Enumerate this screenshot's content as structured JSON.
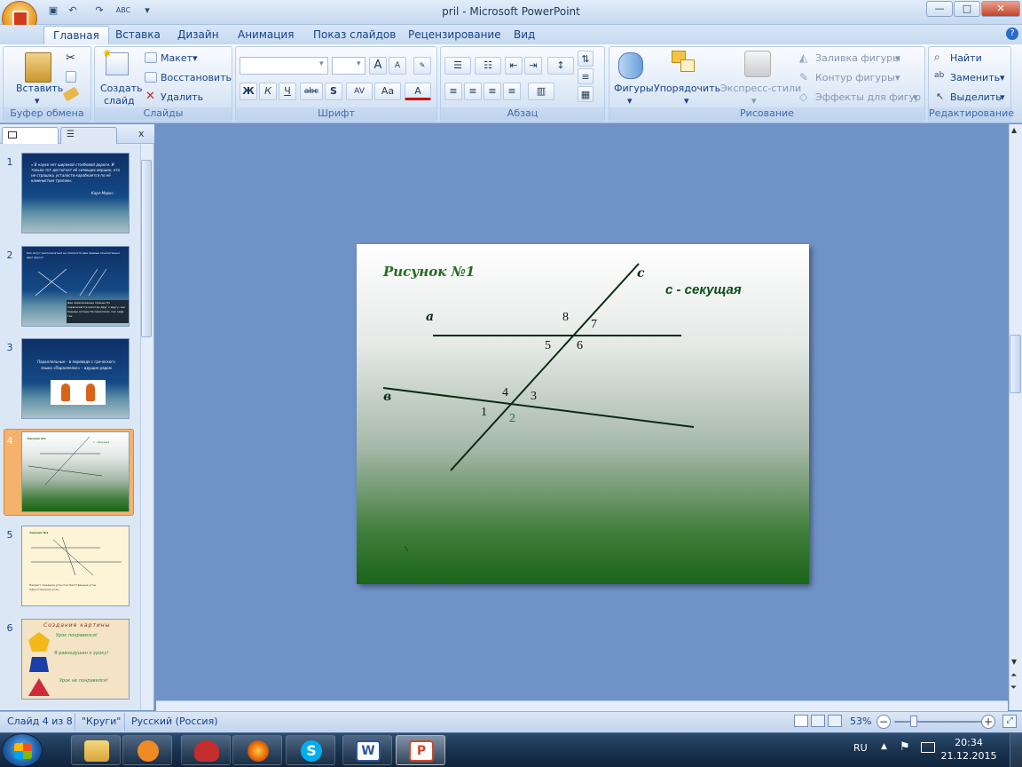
{
  "window": {
    "title": "pril - Microsoft PowerPoint",
    "min": "—",
    "max": "□",
    "close": "✕"
  },
  "qat": {
    "save": "💾",
    "undo": "↶",
    "redo": "↷",
    "spell": "ABC"
  },
  "tabs": [
    "Главная",
    "Вставка",
    "Дизайн",
    "Анимация",
    "Показ слайдов",
    "Рецензирование",
    "Вид"
  ],
  "ribbon": {
    "clipboard": {
      "label": "Буфер обмена",
      "paste": "Вставить"
    },
    "slides": {
      "label": "Слайды",
      "create": "Создать",
      "create2": "слайд",
      "layout": "Макет",
      "reset": "Восстановить",
      "delete": "Удалить"
    },
    "font": {
      "label": "Шрифт",
      "bold": "Ж",
      "italic": "К",
      "underline": "Ч",
      "strike": "abc",
      "shadow": "S",
      "spacing": "AV",
      "case": "Aa",
      "color": "A",
      "grow": "A",
      "shrink": "A"
    },
    "paragraph": {
      "label": "Абзац"
    },
    "drawing": {
      "label": "Рисование",
      "shapes": "Фигуры",
      "arrange": "Упорядочить",
      "styles": "Экспресс-стили",
      "fill": "Заливка фигуры",
      "outline": "Контур фигуры",
      "effects": "Эффекты для фигур"
    },
    "editing": {
      "label": "Редактирование",
      "find": "Найти",
      "replace": "Заменить",
      "select": "Выделить"
    }
  },
  "thumbnails": [
    {
      "num": "1",
      "text": "« В науке нет широкой столбовой дороги. И только тот достигнет её сияющих вершин, кто не страшась усталости карабкается по её каменистым тропам».",
      "author": "Карл Маркс."
    },
    {
      "num": "2",
      "text": "Как могут располагаться на плоскости две прямые относительно друг друга?",
      "caption": "Две пересекаемые прямые На пересекаются никогда Друг к другу, как бедные актеры На параллели, как нерв тех"
    },
    {
      "num": "3",
      "text": "Параллельные – в переводе с греческого языка «Параллелос» – идущие рядом"
    },
    {
      "num": "4",
      "text": "Рисунок №1",
      "caption": "с - секущая"
    },
    {
      "num": "5",
      "text": "Задание №1",
      "caption": "Накрест лежащие углы Соответственные углы Односторонние углы"
    },
    {
      "num": "6",
      "text": "Создание картины",
      "l1": "Урок понравился!",
      "l2": "Я равнодушен к уроку!",
      "l3": "Урок не понравился!"
    }
  ],
  "panel": {
    "close": "x"
  },
  "slide": {
    "title": "Рисунок №1",
    "caption": "с - секущая",
    "line_a": "а",
    "line_b": "в",
    "line_c": "с",
    "angles": [
      "1",
      "2",
      "3",
      "4",
      "5",
      "6",
      "7",
      "8"
    ]
  },
  "status": {
    "slide": "Слайд 4 из 8",
    "theme": "\"Круги\"",
    "lang": "Русский (Россия)",
    "zoom": "53%"
  },
  "taskbar": {
    "lang": "RU",
    "time": "20:34",
    "date": "21.12.2015"
  }
}
